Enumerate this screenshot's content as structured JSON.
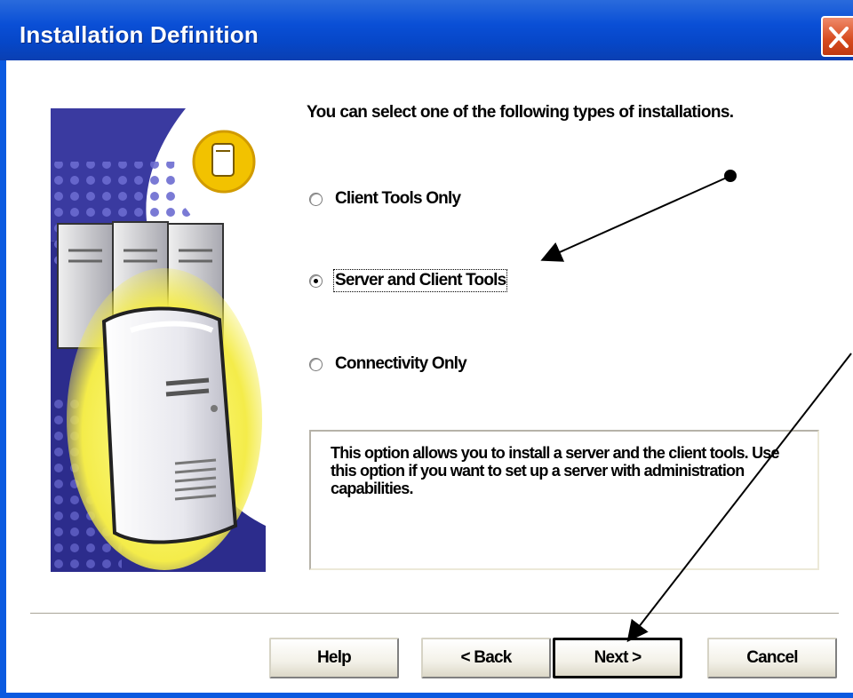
{
  "window": {
    "title": "Installation Definition",
    "close_icon": "close-icon"
  },
  "intro_text": "You can select one of the following types of installations.",
  "options": [
    {
      "label": "Client Tools Only",
      "selected": false
    },
    {
      "label": "Server and Client Tools",
      "selected": true
    },
    {
      "label": "Connectivity Only",
      "selected": false
    }
  ],
  "description": "This option allows you to install a server and the client tools. Use this option if you want to set up a server with administration capabilities.",
  "buttons": {
    "help": "Help",
    "back": "< Back",
    "next": "Next >",
    "cancel": "Cancel"
  },
  "colors": {
    "titlebar": "#0a4fd6",
    "close": "#d64a1e",
    "illustration_bg": "#3a3a9a",
    "highlight_glow": "#f4ec4a"
  }
}
